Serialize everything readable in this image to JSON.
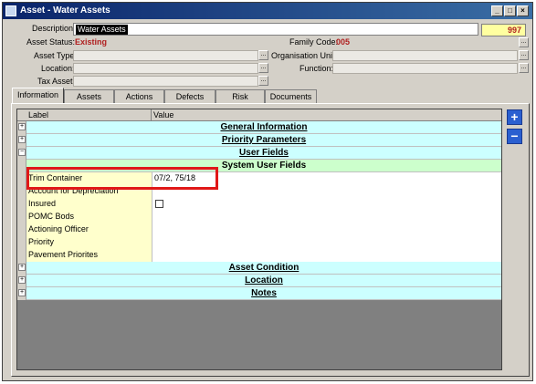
{
  "window": {
    "title": "Asset - Water Assets",
    "minimize": "_",
    "maximize": "□",
    "close": "×"
  },
  "header": {
    "description_label": "Description:",
    "description_value": "Water Assets",
    "asset_status_label": "Asset Status:",
    "asset_status_value": "Existing",
    "family_code_label": "Family Code:",
    "family_code_value": "005",
    "asset_number": "997",
    "asset_type_label": "Asset Type:",
    "organisation_unit_label": "Organisation Unit:",
    "location_label": "Location:",
    "function_label": "Function:",
    "tax_asset_label": "Tax Asset:",
    "lookup_button": "..."
  },
  "tabs": [
    "Information",
    "Assets",
    "Actions",
    "Defects",
    "Risk",
    "Documents"
  ],
  "grid": {
    "col_label": "Label",
    "col_value": "Value",
    "rows": {
      "general_information": "General Information",
      "priority_parameters": "Priority Parameters",
      "user_fields": "User Fields",
      "system_user_fields": "System User Fields",
      "trim_container_label": "Trim Container",
      "trim_container_value": "07/2, 75/18",
      "account_depreciation": "Account for Depreciation",
      "insured": "Insured",
      "pomc_bods": "POMC Bods",
      "actioning_officer": "Actioning Officer",
      "priority": "Priority",
      "pavement_priorites": "Pavement Priorites",
      "asset_condition": "Asset Condition",
      "location": "Location",
      "notes": "Notes"
    },
    "expand_glyph": "+",
    "collapse_glyph": "−"
  },
  "side_buttons": {
    "add": "+",
    "remove": "−"
  },
  "colors": {
    "category_row": "#ccffff",
    "system_row": "#ccffcc",
    "label_cell": "#ffffcc",
    "highlight": "#e01818",
    "status_red": "#b02020"
  }
}
